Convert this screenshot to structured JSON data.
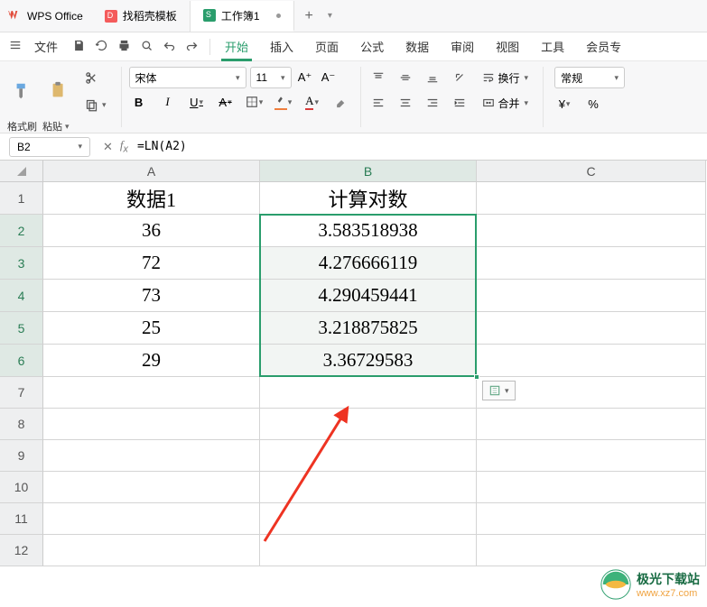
{
  "app": {
    "name": "WPS Office"
  },
  "tabs": [
    {
      "label": "找稻壳模板",
      "icon": "d",
      "active": false
    },
    {
      "label": "工作簿1",
      "icon": "s",
      "active": true,
      "modified": true
    }
  ],
  "addTab": "+",
  "menubar": {
    "file": "文件",
    "items": [
      "开始",
      "插入",
      "页面",
      "公式",
      "数据",
      "审阅",
      "视图",
      "工具"
    ],
    "activeIndex": 0,
    "truncated": "会员专"
  },
  "ribbon": {
    "formatBrush": "格式刷",
    "paste": "粘贴",
    "fontName": "宋体",
    "fontSize": "11",
    "aplus": "A⁺",
    "aminus": "A⁻",
    "bold": "B",
    "italic": "I",
    "underline": "U",
    "strike": "A",
    "wrap": "换行",
    "merge": "合并",
    "numFormat": "常规",
    "currency": "¥",
    "percent": "%"
  },
  "nameBox": "B2",
  "formula": "=LN(A2)",
  "columns": [
    "A",
    "B",
    "C"
  ],
  "rowHeaders": [
    "1",
    "2",
    "3",
    "4",
    "5",
    "6",
    "7",
    "8",
    "9",
    "10",
    "11",
    "12"
  ],
  "data": {
    "A": {
      "header": "数据1",
      "values": [
        "36",
        "72",
        "73",
        "25",
        "29"
      ]
    },
    "B": {
      "header": "计算对数",
      "values": [
        "3.583518938",
        "4.276666119",
        "4.290459441",
        "3.218875825",
        "3.36729583"
      ]
    }
  },
  "selection": {
    "range": "B2:B6",
    "active": "B2"
  },
  "watermark": {
    "cn": "极光下载站",
    "url": "www.xz7.com"
  },
  "chart_data": {
    "type": "table",
    "columns": [
      "数据1",
      "计算对数"
    ],
    "rows": [
      [
        36,
        3.583518938
      ],
      [
        72,
        4.276666119
      ],
      [
        73,
        4.290459441
      ],
      [
        25,
        3.218875825
      ],
      [
        29,
        3.36729583
      ]
    ],
    "formula": "=LN(A2)"
  }
}
